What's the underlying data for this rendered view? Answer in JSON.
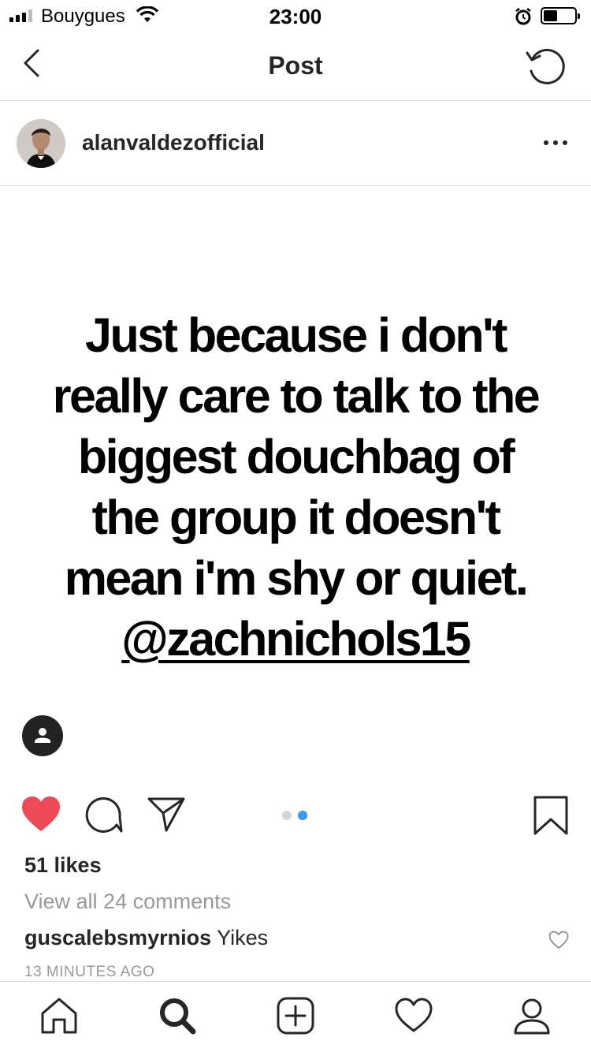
{
  "status_bar": {
    "carrier": "Bouygues",
    "time": "23:00"
  },
  "nav": {
    "title": "Post"
  },
  "post": {
    "username": "alanvaldezofficial",
    "quote_lines": [
      "Just because i don't",
      "really care to talk to the",
      "biggest douchbag of",
      "the group it doesn't",
      "mean i'm shy or quiet."
    ],
    "mention": "@zachnichols15",
    "carousel": {
      "count": 2,
      "active_index": 1
    },
    "likes": "51 likes",
    "view_comments": "View all 24 comments",
    "comment": {
      "user": "guscalebsmyrnios",
      "text": "Yikes"
    },
    "timestamp": "13 MINUTES AGO"
  },
  "colors": {
    "like_red": "#ed4956",
    "dot_active": "#3897f0",
    "muted_text": "#999999",
    "divider": "#dbdbdb"
  },
  "icons": {
    "nav_back": "chevron-left-icon",
    "nav_refresh": "refresh-icon",
    "more": "more-horizontal-icon",
    "like": "heart-filled-icon",
    "comment": "comment-bubble-icon",
    "share": "paper-plane-icon",
    "save": "bookmark-icon",
    "tabs": [
      "home-icon",
      "search-icon",
      "add-post-icon",
      "activity-heart-icon",
      "profile-icon"
    ]
  }
}
